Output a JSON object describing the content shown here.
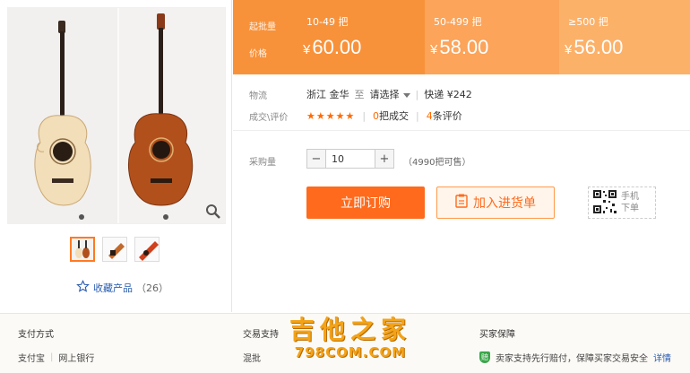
{
  "price_band": {
    "label_batch": "起批量",
    "label_price": "价格",
    "tiers": [
      {
        "range": "10-49 把",
        "currency": "¥",
        "price": "60.00"
      },
      {
        "range": "50-499 把",
        "currency": "¥",
        "price": "58.00"
      },
      {
        "range": "≥500 把",
        "currency": "¥",
        "price": "56.00"
      }
    ]
  },
  "logistics": {
    "label": "物流",
    "origin": "浙江 金华",
    "to": "至",
    "destination_select": "请选择",
    "separator": "|",
    "express": "快递 ¥242"
  },
  "reviews": {
    "label": "成交\\评价",
    "stars": "★★★★★",
    "sold_count": "0",
    "sold_label": "把成交",
    "review_count": "4",
    "review_label": "条评价"
  },
  "quantity": {
    "label": "采购量",
    "minus": "−",
    "value": "10",
    "plus": "+",
    "available": "（4990把可售）"
  },
  "actions": {
    "order": "立即订购",
    "add_to_list": "加入进货单",
    "mobile_line1": "手机",
    "mobile_line2": "下单"
  },
  "favorite": {
    "label": "收藏产品",
    "count": "（26）"
  },
  "footer": {
    "payment_title": "支付方式",
    "payment_items": [
      "支付宝",
      "|",
      "网上银行"
    ],
    "trade_title": "交易支持",
    "trade_item": "混批",
    "protect_title": "买家保障",
    "protect_text": "卖家支持先行赔付，保障买家交易安全",
    "protect_link": "详情"
  },
  "watermark": {
    "line1": "吉他之家",
    "line2": "798COM.COM"
  },
  "colors": {
    "accent": "#ff6a1c",
    "band": "#f8923a",
    "link": "#2a5db0"
  }
}
